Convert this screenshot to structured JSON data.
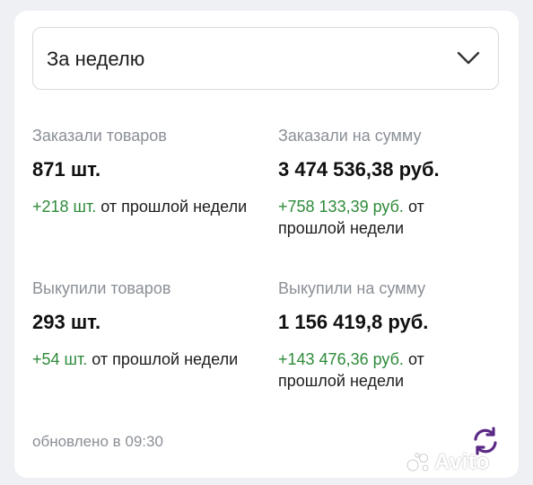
{
  "period_select": {
    "value": "За неделю"
  },
  "stats": {
    "ordered_items": {
      "label": "Заказали товаров",
      "value": "871 шт.",
      "delta": "+218 шт.",
      "delta_suffix": "от прошлой недели"
    },
    "ordered_sum": {
      "label": "Заказали на сумму",
      "value": "3 474 536,38 руб.",
      "delta": "+758 133,39 руб.",
      "delta_suffix": "от прошлой недели"
    },
    "bought_items": {
      "label": "Выкупили товаров",
      "value": "293 шт.",
      "delta": "+54 шт.",
      "delta_suffix": "от прошлой недели"
    },
    "bought_sum": {
      "label": "Выкупили на сумму",
      "value": "1 156 419,8 руб.",
      "delta": "+143 476,36 руб.",
      "delta_suffix": "от прошлой недели"
    }
  },
  "updated_text": "обновлено в 09:30",
  "watermark": "Avito",
  "colors": {
    "positive": "#2e8b3a",
    "muted": "#8a8f96",
    "accent": "#5b2a86"
  },
  "icons": {
    "dropdown": "chevron-down-icon",
    "refresh": "refresh-icon"
  }
}
